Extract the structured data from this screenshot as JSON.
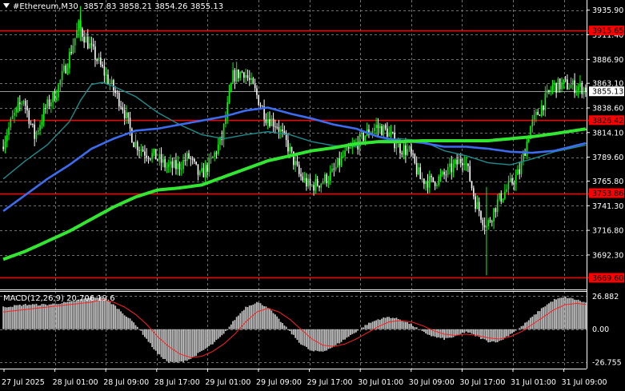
{
  "header": {
    "symbol": "#Ethereum,M30",
    "ohlc": "3857.83 3858.21 3854.26 3855.13"
  },
  "macd_label": "MACD(12,26,9) 20.706 19.6",
  "colors": {
    "background": "#000000",
    "grid": "#6f6f6f",
    "bull": "#00ff00",
    "bear": "#ffffff",
    "ma_fast": "#1e8c8c",
    "ma_mid": "#3c6cf0",
    "ma_slow": "#32e632",
    "level": "#ff0000",
    "macd_hist": "#c0c0c0",
    "macd_signal": "#ff2020"
  },
  "chart_data": [
    {
      "type": "candlestick",
      "symbol": "#Ethereum",
      "timeframe": "M30",
      "ylim": [
        3658,
        3946
      ],
      "y_ticks": [
        "3935.90",
        "3911.40",
        "3886.90",
        "3863.10",
        "3838.60",
        "3814.10",
        "3789.60",
        "3765.80",
        "3741.30",
        "3716.80",
        "3692.30"
      ],
      "y_tick_values": [
        3935.9,
        3911.4,
        3886.9,
        3863.1,
        3838.6,
        3814.1,
        3789.6,
        3765.8,
        3741.3,
        3716.8,
        3692.3
      ],
      "x_ticks": [
        "27 Jul 2025",
        "28 Jul 01:00",
        "28 Jul 09:00",
        "28 Jul 17:00",
        "29 Jul 01:00",
        "29 Jul 09:00",
        "29 Jul 17:00",
        "30 Jul 01:00",
        "30 Jul 09:00",
        "30 Jul 17:00",
        "31 Jul 01:00",
        "31 Jul 09:00"
      ],
      "levels": [
        {
          "value": 3915.65,
          "label": "3915.65"
        },
        {
          "value": 3826.42,
          "label": "3826.42"
        },
        {
          "value": 3753.86,
          "label": "3753.86"
        },
        {
          "value": 3669.6,
          "label": "3669.60"
        }
      ],
      "current_price": {
        "value": 3855.13,
        "label": "3855.13"
      },
      "close_path": [
        [
          0,
          3800
        ],
        [
          6,
          3828
        ],
        [
          12,
          3848
        ],
        [
          18,
          3810
        ],
        [
          24,
          3838
        ],
        [
          30,
          3855
        ],
        [
          36,
          3885
        ],
        [
          42,
          3920
        ],
        [
          48,
          3900
        ],
        [
          54,
          3880
        ],
        [
          60,
          3860
        ],
        [
          66,
          3840
        ],
        [
          72,
          3805
        ],
        [
          78,
          3795
        ],
        [
          84,
          3790
        ],
        [
          90,
          3780
        ],
        [
          96,
          3780
        ],
        [
          102,
          3790
        ],
        [
          108,
          3770
        ],
        [
          114,
          3785
        ],
        [
          120,
          3808
        ],
        [
          126,
          3870
        ],
        [
          132,
          3875
        ],
        [
          138,
          3855
        ],
        [
          144,
          3830
        ],
        [
          150,
          3822
        ],
        [
          156,
          3800
        ],
        [
          162,
          3772
        ],
        [
          168,
          3760
        ],
        [
          174,
          3765
        ],
        [
          180,
          3773
        ],
        [
          186,
          3790
        ],
        [
          192,
          3800
        ],
        [
          198,
          3812
        ],
        [
          204,
          3820
        ],
        [
          210,
          3815
        ],
        [
          216,
          3800
        ],
        [
          222,
          3795
        ],
        [
          228,
          3768
        ],
        [
          234,
          3765
        ],
        [
          240,
          3770
        ],
        [
          246,
          3780
        ],
        [
          252,
          3790
        ],
        [
          258,
          3745
        ],
        [
          264,
          3720
        ],
        [
          270,
          3745
        ],
        [
          276,
          3760
        ],
        [
          282,
          3775
        ],
        [
          288,
          3820
        ],
        [
          294,
          3840
        ],
        [
          300,
          3860
        ],
        [
          306,
          3862
        ],
        [
          312,
          3860
        ],
        [
          318,
          3858
        ]
      ],
      "ma_fast_path": [
        [
          0,
          3768
        ],
        [
          12,
          3786
        ],
        [
          24,
          3802
        ],
        [
          36,
          3825
        ],
        [
          42,
          3846
        ],
        [
          48,
          3862
        ],
        [
          54,
          3864
        ],
        [
          60,
          3860
        ],
        [
          72,
          3850
        ],
        [
          84,
          3834
        ],
        [
          96,
          3822
        ],
        [
          108,
          3812
        ],
        [
          120,
          3808
        ],
        [
          132,
          3812
        ],
        [
          144,
          3815
        ],
        [
          156,
          3812
        ],
        [
          168,
          3805
        ],
        [
          180,
          3801
        ],
        [
          192,
          3801
        ],
        [
          204,
          3806
        ],
        [
          216,
          3808
        ],
        [
          228,
          3806
        ],
        [
          240,
          3796
        ],
        [
          252,
          3791
        ],
        [
          264,
          3784
        ],
        [
          276,
          3782
        ],
        [
          288,
          3788
        ],
        [
          300,
          3795
        ],
        [
          318,
          3802
        ]
      ],
      "ma_mid_path": [
        [
          0,
          3736
        ],
        [
          12,
          3752
        ],
        [
          24,
          3768
        ],
        [
          36,
          3782
        ],
        [
          48,
          3798
        ],
        [
          60,
          3808
        ],
        [
          72,
          3816
        ],
        [
          84,
          3818
        ],
        [
          96,
          3822
        ],
        [
          108,
          3826
        ],
        [
          120,
          3830
        ],
        [
          132,
          3836
        ],
        [
          144,
          3839
        ],
        [
          156,
          3833
        ],
        [
          168,
          3828
        ],
        [
          180,
          3822
        ],
        [
          192,
          3818
        ],
        [
          204,
          3810
        ],
        [
          216,
          3806
        ],
        [
          228,
          3804
        ],
        [
          240,
          3800
        ],
        [
          252,
          3800
        ],
        [
          264,
          3798
        ],
        [
          276,
          3795
        ],
        [
          288,
          3794
        ],
        [
          300,
          3796
        ],
        [
          318,
          3804
        ]
      ],
      "ma_slow_path": [
        [
          0,
          3688
        ],
        [
          12,
          3696
        ],
        [
          24,
          3706
        ],
        [
          36,
          3716
        ],
        [
          48,
          3728
        ],
        [
          60,
          3740
        ],
        [
          72,
          3750
        ],
        [
          84,
          3757
        ],
        [
          96,
          3759
        ],
        [
          108,
          3762
        ],
        [
          120,
          3770
        ],
        [
          132,
          3778
        ],
        [
          144,
          3786
        ],
        [
          156,
          3791
        ],
        [
          168,
          3796
        ],
        [
          180,
          3799
        ],
        [
          192,
          3803
        ],
        [
          204,
          3805
        ],
        [
          216,
          3805
        ],
        [
          228,
          3806
        ],
        [
          240,
          3806
        ],
        [
          252,
          3806
        ],
        [
          264,
          3806
        ],
        [
          276,
          3808
        ],
        [
          288,
          3810
        ],
        [
          300,
          3813
        ],
        [
          318,
          3818
        ]
      ]
    },
    {
      "type": "macd_histogram",
      "label": "MACD(12,26,9) 20.706 19.6",
      "ylim": [
        -32,
        31
      ],
      "y_ticks": [
        "26.882",
        "0.00",
        "-26.755"
      ],
      "y_tick_values": [
        26.882,
        0,
        -26.755
      ],
      "hist_path": [
        [
          0,
          18
        ],
        [
          12,
          20
        ],
        [
          24,
          20
        ],
        [
          36,
          22
        ],
        [
          42,
          24
        ],
        [
          48,
          26
        ],
        [
          54,
          26
        ],
        [
          60,
          20
        ],
        [
          66,
          12
        ],
        [
          72,
          4
        ],
        [
          78,
          -8
        ],
        [
          84,
          -20
        ],
        [
          90,
          -27
        ],
        [
          96,
          -27
        ],
        [
          102,
          -24
        ],
        [
          108,
          -18
        ],
        [
          114,
          -12
        ],
        [
          120,
          -4
        ],
        [
          126,
          8
        ],
        [
          132,
          18
        ],
        [
          138,
          22
        ],
        [
          144,
          18
        ],
        [
          150,
          8
        ],
        [
          156,
          -2
        ],
        [
          162,
          -12
        ],
        [
          168,
          -18
        ],
        [
          174,
          -18
        ],
        [
          180,
          -14
        ],
        [
          186,
          -8
        ],
        [
          192,
          -2
        ],
        [
          198,
          4
        ],
        [
          204,
          8
        ],
        [
          210,
          10
        ],
        [
          216,
          8
        ],
        [
          222,
          4
        ],
        [
          228,
          -2
        ],
        [
          234,
          -6
        ],
        [
          240,
          -8
        ],
        [
          246,
          -6
        ],
        [
          252,
          -2
        ],
        [
          258,
          -6
        ],
        [
          264,
          -10
        ],
        [
          270,
          -10
        ],
        [
          276,
          -4
        ],
        [
          282,
          2
        ],
        [
          288,
          10
        ],
        [
          294,
          18
        ],
        [
          300,
          24
        ],
        [
          306,
          26
        ],
        [
          312,
          24
        ],
        [
          318,
          21
        ]
      ],
      "signal_path": [
        [
          0,
          14
        ],
        [
          12,
          16
        ],
        [
          24,
          18
        ],
        [
          36,
          20
        ],
        [
          48,
          22
        ],
        [
          54,
          24
        ],
        [
          60,
          22
        ],
        [
          66,
          18
        ],
        [
          72,
          12
        ],
        [
          78,
          4
        ],
        [
          84,
          -6
        ],
        [
          90,
          -14
        ],
        [
          96,
          -20
        ],
        [
          102,
          -23
        ],
        [
          108,
          -22
        ],
        [
          114,
          -18
        ],
        [
          120,
          -12
        ],
        [
          126,
          -4
        ],
        [
          132,
          6
        ],
        [
          138,
          14
        ],
        [
          144,
          17
        ],
        [
          150,
          14
        ],
        [
          156,
          8
        ],
        [
          162,
          0
        ],
        [
          168,
          -8
        ],
        [
          174,
          -13
        ],
        [
          180,
          -14
        ],
        [
          186,
          -12
        ],
        [
          192,
          -8
        ],
        [
          198,
          -3
        ],
        [
          204,
          2
        ],
        [
          210,
          6
        ],
        [
          216,
          7
        ],
        [
          222,
          6
        ],
        [
          228,
          3
        ],
        [
          234,
          -1
        ],
        [
          240,
          -4
        ],
        [
          246,
          -5
        ],
        [
          252,
          -4
        ],
        [
          258,
          -5
        ],
        [
          264,
          -7
        ],
        [
          270,
          -8
        ],
        [
          276,
          -6
        ],
        [
          282,
          -2
        ],
        [
          288,
          4
        ],
        [
          294,
          10
        ],
        [
          300,
          16
        ],
        [
          306,
          20
        ],
        [
          312,
          21
        ],
        [
          318,
          20
        ]
      ]
    }
  ]
}
